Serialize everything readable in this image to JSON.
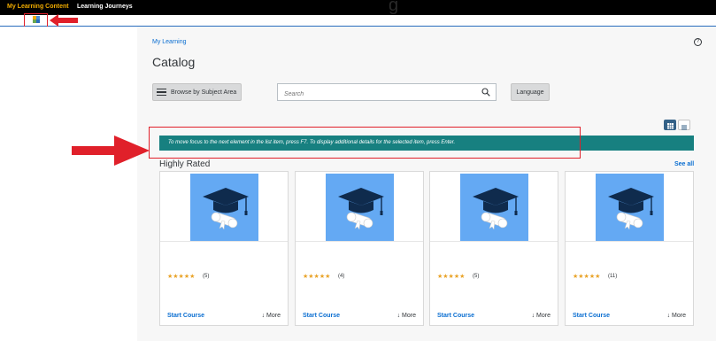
{
  "shell": {
    "tabs": [
      "My Learning Content",
      "Learning Journeys"
    ],
    "title_fragment": "g"
  },
  "breadcrumb": "My Learning",
  "page_title": "Catalog",
  "toolbar": {
    "browse_label": "Browse by Subject Area",
    "search_placeholder": "Search",
    "language_label": "Language"
  },
  "help_glyph": "?",
  "banner_text": "To move focus to the next element in the list item, press F7. To display additional details for the selected item, press Enter.",
  "section": {
    "title": "Highly Rated",
    "see_all": "See all"
  },
  "cards": [
    {
      "stars": "★★★★★",
      "count": "(5)",
      "start_label": "Start Course",
      "more_label": "↓ More"
    },
    {
      "stars": "★★★★★",
      "count": "(4)",
      "start_label": "Start Course",
      "more_label": "↓ More"
    },
    {
      "stars": "★★★★★",
      "count": "(5)",
      "start_label": "Start Course",
      "more_label": "↓ More"
    },
    {
      "stars": "★★★★★",
      "count": "(11)",
      "start_label": "Start Course",
      "more_label": "↓ More"
    }
  ],
  "colors": {
    "accent_tab": "#f0ab00",
    "banner": "#178080",
    "link": "#0a6ed1",
    "thumbnail": "#64a9f3",
    "annotation": "#e0202a"
  },
  "icons": [
    "shell-app-icon",
    "hamburger-icon",
    "search-icon",
    "help-icon",
    "grid-view-icon",
    "list-view-icon",
    "graduation-cap-icon",
    "diploma-icon"
  ]
}
